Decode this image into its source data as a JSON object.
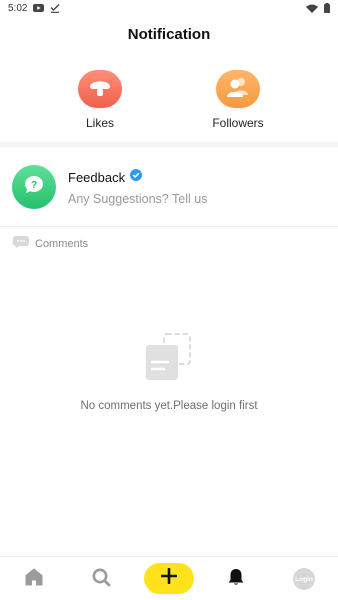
{
  "status_bar": {
    "time": "5:02",
    "icons": [
      "youtube-icon",
      "download-check-icon",
      "wifi-icon",
      "battery-icon"
    ]
  },
  "header": {
    "title": "Notification"
  },
  "categories": [
    {
      "label": "Likes",
      "icon": "mushroom-icon",
      "color": "#f0604b"
    },
    {
      "label": "Followers",
      "icon": "users-icon",
      "color": "#f39a3f"
    }
  ],
  "feedback": {
    "title": "Feedback",
    "verified_icon": "verified-badge-icon",
    "subtitle": "Any Suggestions? Tell us",
    "avatar_color": "#24c16e"
  },
  "comments": {
    "label": "Comments",
    "icon": "speech-bubble-icon",
    "empty_text": "No comments yet.Please login first",
    "empty_icon": "empty-document-icon"
  },
  "bottom_nav": {
    "items": [
      {
        "name": "home",
        "icon": "home-icon"
      },
      {
        "name": "search",
        "icon": "search-icon"
      },
      {
        "name": "add",
        "icon": "plus-icon",
        "color": "#ffe21a"
      },
      {
        "name": "notifications",
        "icon": "bell-icon",
        "active": true
      },
      {
        "name": "login",
        "label": "Login",
        "icon": "avatar-icon"
      }
    ]
  }
}
